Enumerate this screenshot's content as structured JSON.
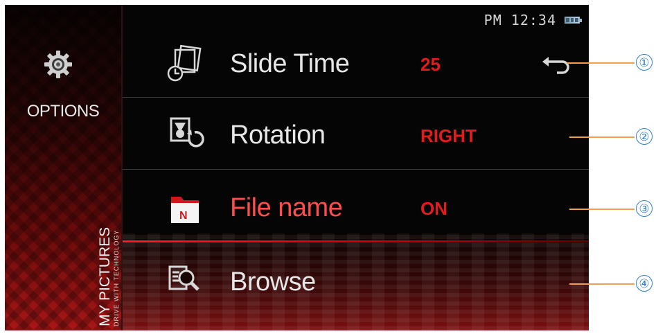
{
  "sidebar": {
    "title": "OPTIONS",
    "gear_icon": "gear-icon",
    "section_title": "MY PICTURES",
    "section_subtitle": "DRIVE WITH TECHNOLOGY"
  },
  "status_bar": {
    "time": "PM 12:34",
    "battery_icon": "battery-icon"
  },
  "menu": {
    "items": [
      {
        "label": "Slide Time",
        "value": "25",
        "icon": "slideshow-icon"
      },
      {
        "label": "Rotation",
        "value": "RIGHT",
        "icon": "rotate-icon"
      },
      {
        "label": "File name",
        "value": "ON",
        "icon": "folder-name-icon"
      },
      {
        "label": "Browse",
        "value": "",
        "icon": "browse-search-icon"
      }
    ],
    "selected_index": 2
  },
  "back_button": {
    "icon": "back-arrow-icon"
  },
  "callouts": [
    "①",
    "②",
    "③",
    "④"
  ],
  "colors": {
    "accent": "#e01c1c",
    "callout_line": "#f0a050",
    "callout_badge": "#2a7fd0"
  }
}
